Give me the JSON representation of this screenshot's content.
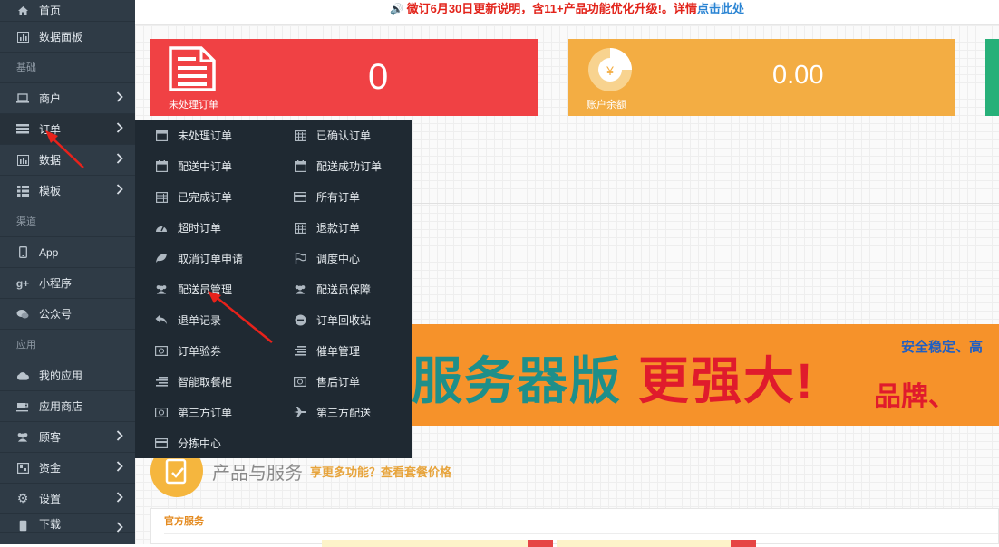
{
  "sidebar": {
    "items": [
      {
        "label": "首页",
        "icon": "home-icon"
      },
      {
        "label": "数据面板",
        "icon": "chart-panel-icon"
      },
      {
        "section": "基础"
      },
      {
        "label": "商户",
        "icon": "laptop-icon",
        "has_children": true
      },
      {
        "label": "订单",
        "icon": "list-icon",
        "has_children": true,
        "active": true
      },
      {
        "label": "数据",
        "icon": "bar-chart-icon",
        "has_children": true
      },
      {
        "label": "模板",
        "icon": "grid-icon",
        "has_children": true
      },
      {
        "section": "渠道"
      },
      {
        "label": "App",
        "icon": "mobile-icon"
      },
      {
        "label": "小程序",
        "icon": "google-plus-icon"
      },
      {
        "label": "公众号",
        "icon": "chat-bubble-icon"
      },
      {
        "section": "应用"
      },
      {
        "label": "我的应用",
        "icon": "cloud-icon"
      },
      {
        "label": "应用商店",
        "icon": "coffee-icon"
      },
      {
        "label": "顾客",
        "icon": "users-icon",
        "has_children": true
      },
      {
        "label": "资金",
        "icon": "wallet-icon",
        "has_children": true
      },
      {
        "label": "设置",
        "icon": "gear-icon",
        "has_children": true
      },
      {
        "label": "下载",
        "icon": "phone-icon",
        "has_children": true
      }
    ]
  },
  "topbar": {
    "notice": "微订6月30日更新说明，含11+产品功能优化升级!。详情",
    "link": "点击此处"
  },
  "cards": {
    "unprocessed": {
      "label": "未处理订单",
      "value": "0",
      "color": "#f04144"
    },
    "balance": {
      "label": "账户余额",
      "value": "0.00",
      "color": "#f3ad43",
      "symbol": "¥"
    },
    "third_color": "#27b079"
  },
  "submenu": {
    "items": [
      {
        "label": "未处理订单",
        "icon": "calendar-icon"
      },
      {
        "label": "已确认订单",
        "icon": "calendar-grid-icon"
      },
      {
        "label": "配送中订单",
        "icon": "calendar-icon"
      },
      {
        "label": "配送成功订单",
        "icon": "calendar-icon"
      },
      {
        "label": "已完成订单",
        "icon": "calendar-grid-icon"
      },
      {
        "label": "所有订单",
        "icon": "credit-card-icon"
      },
      {
        "label": "超时订单",
        "icon": "dashboard-icon"
      },
      {
        "label": "退款订单",
        "icon": "calendar-grid-icon"
      },
      {
        "label": "取消订单申请",
        "icon": "leaf-icon"
      },
      {
        "label": "调度中心",
        "icon": "flag-icon"
      },
      {
        "label": "配送员管理",
        "icon": "users-icon"
      },
      {
        "label": "配送员保障",
        "icon": "users-icon"
      },
      {
        "label": "退单记录",
        "icon": "reply-icon"
      },
      {
        "label": "订单回收站",
        "icon": "minus-circle-icon"
      },
      {
        "label": "订单验券",
        "icon": "money-icon"
      },
      {
        "label": "催单管理",
        "icon": "align-right-icon"
      },
      {
        "label": "智能取餐柜",
        "icon": "align-right-icon"
      },
      {
        "label": "售后订单",
        "icon": "money-icon"
      },
      {
        "label": "第三方订单",
        "icon": "money-icon"
      },
      {
        "label": "第三方配送",
        "icon": "plane-icon"
      },
      {
        "label": "分拣中心",
        "icon": "credit-card-icon"
      }
    ]
  },
  "banner": {
    "main": "服务器版",
    "highlight": "更强大!",
    "small1": "安全稳定、高",
    "small2": "品牌、"
  },
  "products": {
    "title": "产品与服务",
    "subtitle": "享更多功能？查看套餐价格"
  },
  "official": {
    "title": "官方服务"
  }
}
